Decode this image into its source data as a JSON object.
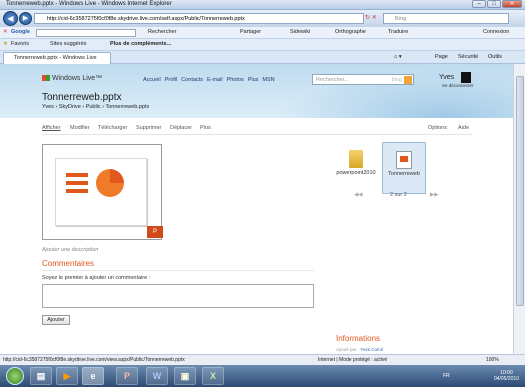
{
  "window": {
    "title": "Tonnerreweb.pptx - Windows Live - Windows Internet Explorer"
  },
  "browser": {
    "address": "http://cid-6c3587275f0cf0f8e.skydrive.live.com/self.aspx/Public/Tonnerreweb.pptx",
    "search_placeholder": "Bing",
    "google_label": "Google",
    "google_search": "Rechercher",
    "google_items": [
      "Partager",
      "Sidewiki",
      "Orthographe",
      "Traduire"
    ],
    "google_connexion": "Connexion",
    "favorites": "Favoris",
    "suggested_sites": "Sites suggérés",
    "more_addons": "Plus de compléments...",
    "tab_title": "Tonnerreweb.pptx - Windows Live",
    "cmd": {
      "page": "Page",
      "security": "Sécurité",
      "tools": "Outils"
    }
  },
  "site": {
    "brand": "Windows Live™",
    "nav": [
      "Accueil",
      "Profil",
      "Contacts",
      "E-mail",
      "Photos",
      "Plus",
      "MSN"
    ],
    "search_placeholder": "Rechercher...",
    "search_engine": "bing",
    "user": "Yves",
    "signout": "Se déconnecter",
    "page_title": "Tonnerreweb.pptx",
    "breadcrumb": "Yves  ›  SkyDrive  ›  Public  ›  Tonnerreweb.pptx"
  },
  "toolbar": {
    "view": "Afficher",
    "edit": "Modifier",
    "download": "Télécharger",
    "delete": "Supprimer",
    "move": "Déplacer",
    "more": "Plus",
    "options": "Options",
    "help": "Aide"
  },
  "files": [
    {
      "name": "powerpoint2010",
      "icon": "folder-icon"
    },
    {
      "name": "Tonnerreweb",
      "icon": "pptx-file-icon"
    }
  ],
  "pager": {
    "text": "2 sur 2"
  },
  "description_link": "Ajouter une description",
  "comments": {
    "header": "Commentaires",
    "prompt": "Soyez le premier à ajouter un commentaire :",
    "add_button": "Ajouter"
  },
  "info": {
    "header": "Informations",
    "added_by_label": "Ajouté par :",
    "added_by": "Yves Comil"
  },
  "statusbar": {
    "url": "http://cid-6c3587275f0cf0f8e.skydrive.live.com/view.aspx/Public/Tonnerreweb.pptx",
    "zone": "Internet | Mode protégé : activé",
    "zoom": "100%"
  },
  "taskbar": {
    "time": "10:00",
    "date": "04/05/2010",
    "lang": "FR"
  },
  "colors": {
    "accent": "#e0581d",
    "link": "#1a3c6e"
  }
}
